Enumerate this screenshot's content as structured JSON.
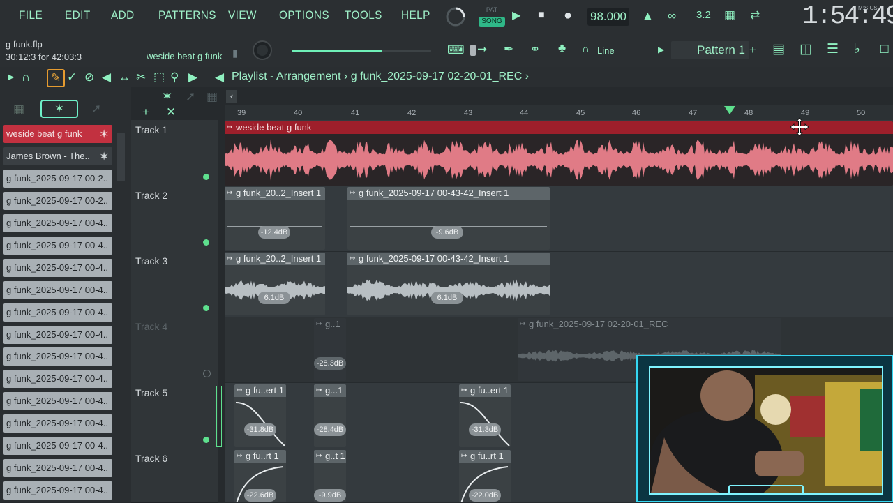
{
  "menu": [
    "FILE",
    "EDIT",
    "ADD",
    "PATTERNS",
    "VIEW",
    "OPTIONS",
    "TOOLS",
    "HELP"
  ],
  "transport": {
    "pat_label": "PAT",
    "song_label": "SONG",
    "tempo": "98.000"
  },
  "clock": {
    "time": "1:54:49",
    "format_label": "M:S:CS"
  },
  "info": {
    "file_name": "g funk.flp",
    "file_time": "30:12:3 for 42:03:3",
    "hint": "weside beat g funk"
  },
  "master": {
    "level": 0.65
  },
  "toolbar": {
    "snap": "Line",
    "pattern": "Pattern 1"
  },
  "playlist": {
    "title": "Playlist - Arrangement",
    "recording": "g funk_2025-09-17 02-20-01_REC"
  },
  "ruler": [
    "39",
    "40",
    "41",
    "42",
    "43",
    "44",
    "45",
    "46",
    "47",
    "48",
    "49",
    "50"
  ],
  "picker": [
    "weside beat g funk",
    "James Brown - The..",
    "g funk_2025-09-17 00-2..",
    "g funk_2025-09-17 00-2..",
    "g funk_2025-09-17 00-4..",
    "g funk_2025-09-17 00-4..",
    "g funk_2025-09-17 00-4..",
    "g funk_2025-09-17 00-4..",
    "g funk_2025-09-17 00-4..",
    "g funk_2025-09-17 00-4..",
    "g funk_2025-09-17 00-4..",
    "g funk_2025-09-17 00-4..",
    "g funk_2025-09-17 00-4..",
    "g funk_2025-09-17 00-4..",
    "g funk_2025-09-17 00-4..",
    "g funk_2025-09-17 00-4..",
    "g funk_2025-09-17 00-4.."
  ],
  "tracks": [
    "Track 1",
    "Track 2",
    "Track 3",
    "Track 4",
    "Track 5",
    "Track 6"
  ],
  "clips": {
    "main": "weside beat g funk",
    "t2a": "g funk_20..2_Insert 1",
    "t2a_db": "-12.4dB",
    "t2b": "g funk_2025-09-17 00-43-42_Insert 1",
    "t2b_db": "-9.6dB",
    "t3a": "g funk_20..2_Insert 1",
    "t3a_db": "6.1dB",
    "t3b": "g funk_2025-09-17 00-43-42_Insert 1",
    "t3b_db": "6.1dB",
    "t4a": "g..1",
    "t4a_db": "-28.3dB",
    "t4b": "g funk_2025-09-17 02-20-01_REC",
    "t5a": "g fu..ert 1",
    "t5a_db": "-31.8dB",
    "t5b": "g...1",
    "t5b_db": "-28.4dB",
    "t5c": "g fu..ert 1",
    "t5c_db": "-31.3dB",
    "t6a": "g fu..rt 1",
    "t6a_db": "-22.6dB",
    "t6b": "g..t 1",
    "t6b_db": "-9.9dB",
    "t6c": "g fu..rt 1",
    "t6c_db": "-22.0dB"
  }
}
